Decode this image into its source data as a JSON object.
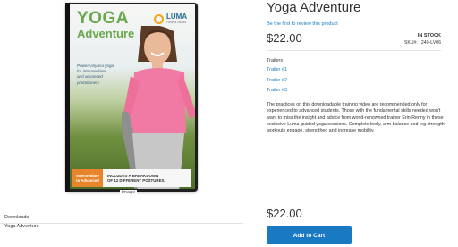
{
  "product": {
    "title": "Yoga Adventure",
    "review_link": "Be the first to review this product",
    "price": "$22.00",
    "stock_status": "In stock",
    "sku_label": "SKU#:",
    "sku_value": "240-LV06"
  },
  "cover": {
    "title_line1": "YOGA",
    "title_line2": "Adventure",
    "brand_name": "LUMA",
    "brand_sub": "Fitness Studio",
    "tagline": [
      "Power vinyasa yoga",
      "for intermediate",
      "and advanced",
      "practitioners"
    ],
    "badge": [
      "Intermediate",
      "to Advanced"
    ],
    "breakdown": [
      "INCLUDES A BREAKDOWN",
      "OF 12 DIFFERENT POSTURES."
    ]
  },
  "gallery": {
    "image_label": "Image"
  },
  "trailers": {
    "heading": "Trailers",
    "items": [
      "Trailer #1",
      "Trailer #2",
      "Trailer #3"
    ]
  },
  "description": "The practices on this downloadable training video are recommended only for experienced to advanced students. Those with the fundamental skills needed won't want to miss the insight and advice from world-renowned trainer Erin Renny in these exclusive Luma guided yoga sessions. Complete body, arm balance and leg strength workouts engage, strengthen and increase mobility.",
  "downloads": {
    "label": "Downloads",
    "item": "Yoga Adventure"
  },
  "purchase": {
    "price": "$22.00",
    "add_to_cart": "Add to Cart"
  },
  "colors": {
    "link": "#1979c3",
    "button": "#1979c3",
    "cover_title": "#6aa84f",
    "badge": "#e8852a"
  }
}
